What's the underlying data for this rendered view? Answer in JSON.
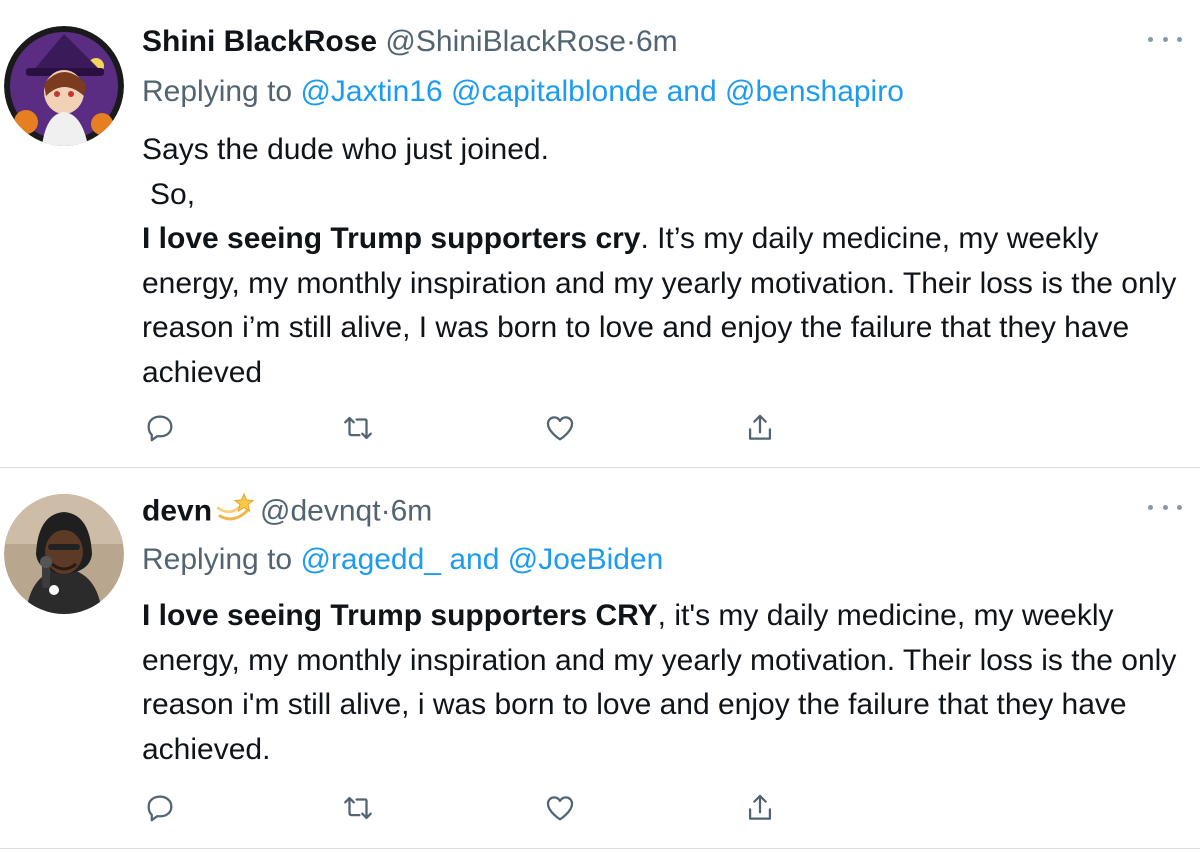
{
  "tweets": [
    {
      "display_name": "Shini BlackRose",
      "handle": "@ShiniBlackRose",
      "separator": "·",
      "time": "6m",
      "replying_prefix": "Replying to",
      "mention_1": "@Jaxtin16",
      "mention_2": "@capitalblonde",
      "and": "and",
      "mention_3": "@benshapiro",
      "line1": "Says the dude who just joined.",
      "line2": "So,",
      "bold": "I love seeing Trump supporters cry",
      "rest": ". It’s my daily medicine, my weekly energy, my monthly inspiration and my yearly motivation. Their loss is the only reason i’m still alive, I was born to love and enjoy the failure that they have achieved"
    },
    {
      "display_name": "devn",
      "handle": "@devnqt",
      "separator": "·",
      "time": "6m",
      "replying_prefix": "Replying to",
      "mention_1": "@ragedd_",
      "and": "and",
      "mention_2": "@JoeBiden",
      "bold": "I love seeing Trump supporters CRY",
      "rest": ", it's my daily medicine, my weekly energy, my monthly inspiration and my yearly motivation. Their loss is the only reason i'm still alive, i was born to love and enjoy the failure that they have achieved."
    }
  ],
  "icons": [
    "reply-icon",
    "retweet-icon",
    "like-icon",
    "share-icon",
    "more-icon",
    "dizzy-emoji-icon"
  ],
  "colors": {
    "link": "#1d9bf0",
    "muted": "#536471",
    "text": "#0f1419",
    "divider": "#d9dde1"
  }
}
